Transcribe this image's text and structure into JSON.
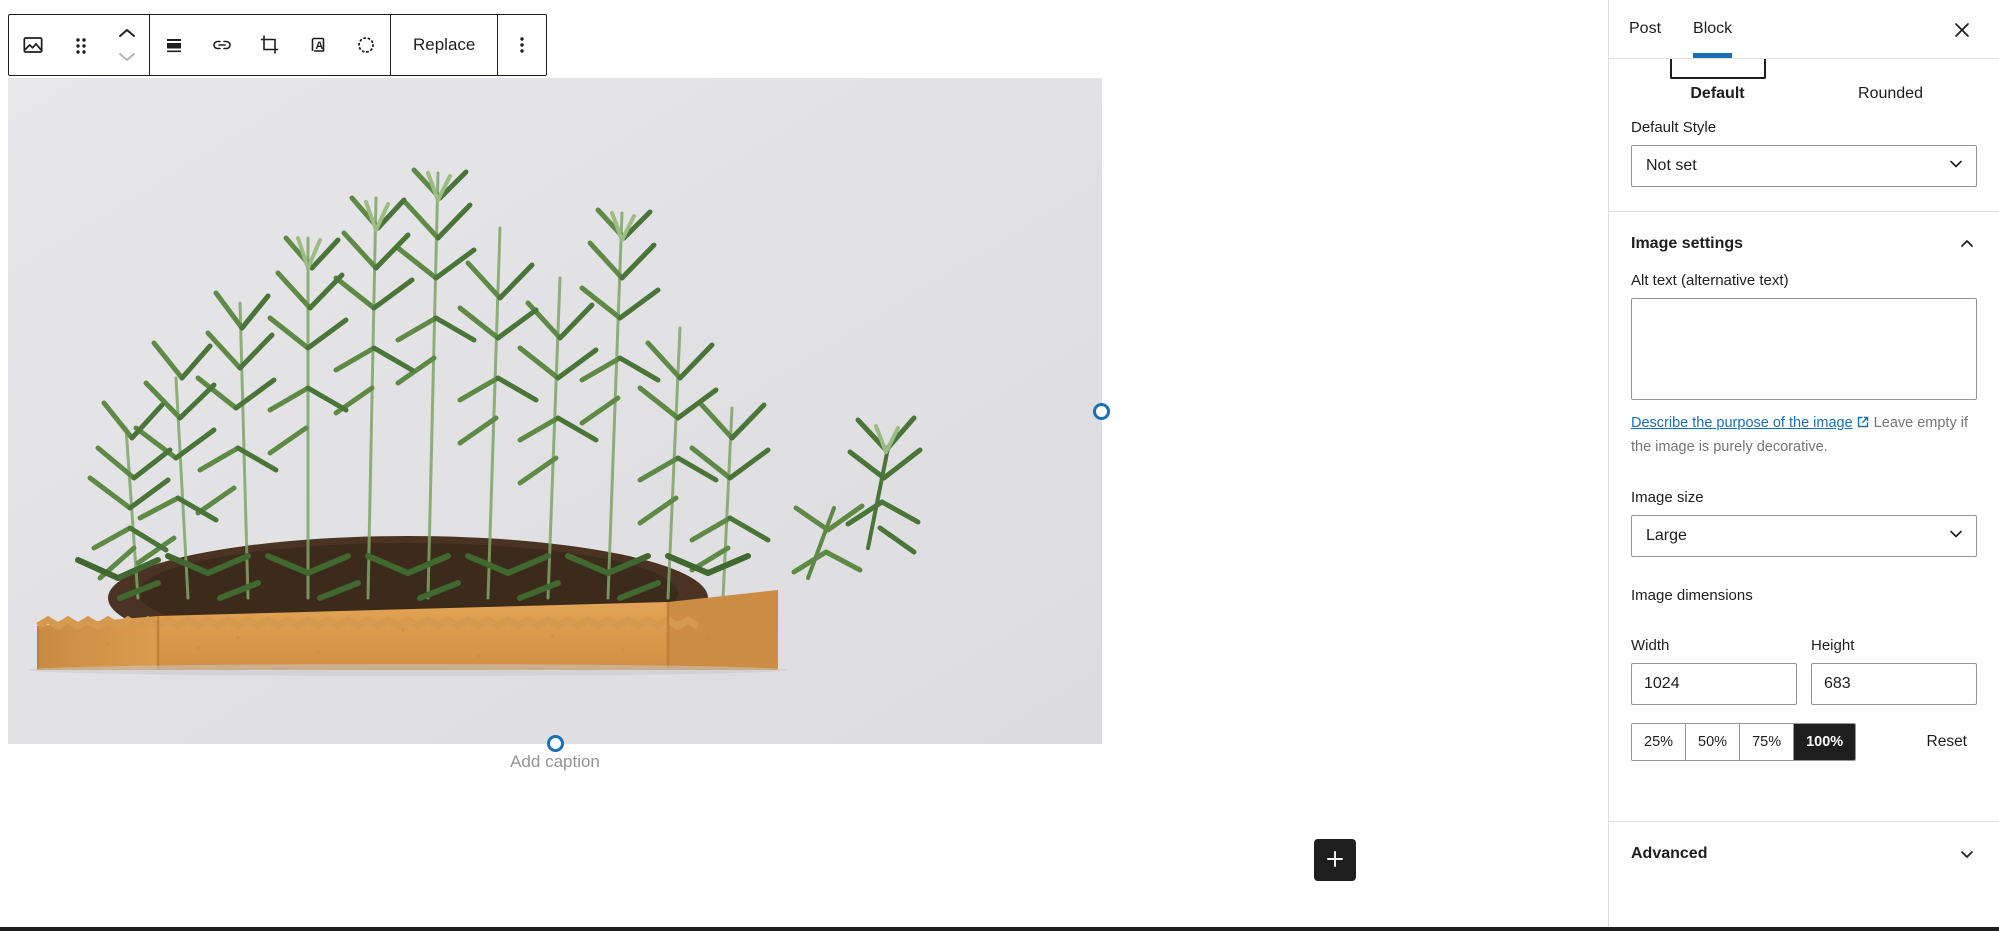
{
  "toolbar": {
    "block_type_icon": "image-icon",
    "drag_handle_icon": "drag-handle-icon",
    "move_up_icon": "chevron-up-icon",
    "move_down_icon": "chevron-down-icon",
    "align_icon": "align-center-icon",
    "link_icon": "link-icon",
    "crop_icon": "crop-icon",
    "text_over_image_icon": "text-over-image-icon",
    "filter_icon": "duotone-filter-icon",
    "replace_label": "Replace",
    "more_options_icon": "more-options-icon"
  },
  "canvas": {
    "caption_placeholder": "Add caption",
    "resize_handle_right": "resize-handle-right",
    "resize_handle_bottom": "resize-handle-bottom",
    "add_block_icon": "plus-icon",
    "image_alt": "Rosemary plant in a kraft paper pot on a light grey background"
  },
  "sidebar": {
    "tabs": [
      {
        "label": "Post",
        "active": false
      },
      {
        "label": "Block",
        "active": true
      }
    ],
    "close_icon": "close-icon",
    "styles": {
      "items": [
        {
          "label": "Default",
          "selected": true
        },
        {
          "label": "Rounded",
          "selected": false
        }
      ],
      "default_style_label": "Default Style",
      "default_style_value": "Not set"
    },
    "image_settings": {
      "title": "Image settings",
      "collapse_icon": "chevron-up-icon",
      "alt_text_label": "Alt text (alternative text)",
      "alt_text_value": "",
      "help_link": "Describe the purpose of the image",
      "help_link_icon": "external-link-icon",
      "help_text": " Leave empty if the image is purely decorative.",
      "image_size_label": "Image size",
      "image_size_value": "Large",
      "image_dimensions_label": "Image dimensions",
      "width_label": "Width",
      "width_value": "1024",
      "height_label": "Height",
      "height_value": "683",
      "percentages": [
        {
          "label": "25%",
          "active": false
        },
        {
          "label": "50%",
          "active": false
        },
        {
          "label": "75%",
          "active": false
        },
        {
          "label": "100%",
          "active": true
        }
      ],
      "reset_label": "Reset"
    },
    "advanced": {
      "title": "Advanced",
      "expand_icon": "chevron-down-icon"
    }
  },
  "colors": {
    "accent": "#1a6fb5",
    "text": "#1e1e1e",
    "muted": "#757575",
    "border": "#949494",
    "divider": "#e0e0e0",
    "active_fill": "#1e1e1e"
  }
}
